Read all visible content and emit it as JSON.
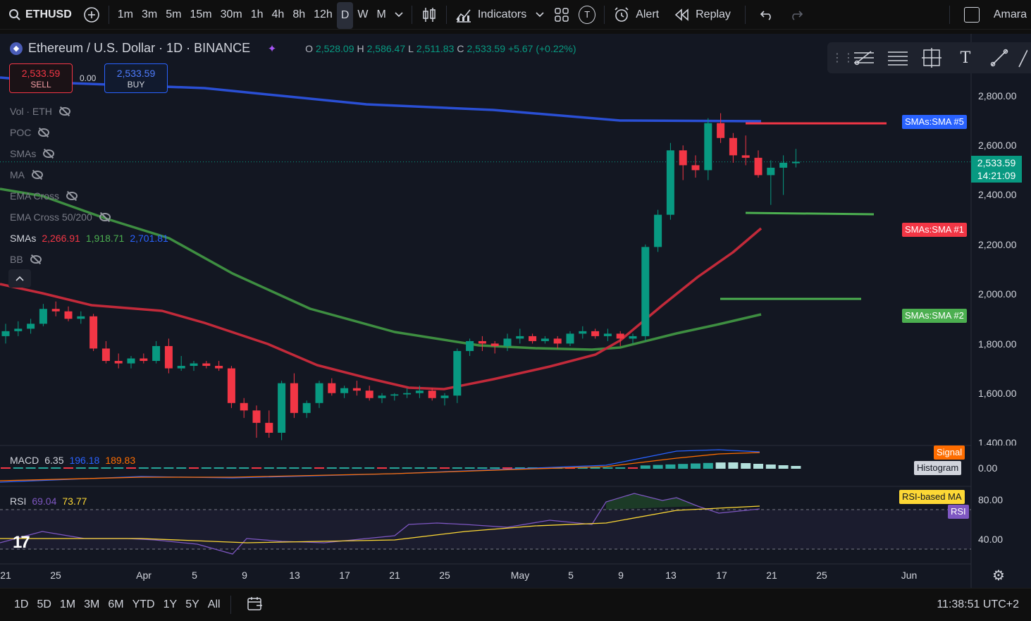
{
  "topbar": {
    "symbol": "ETHUSD",
    "intervals": [
      "1m",
      "3m",
      "5m",
      "15m",
      "30m",
      "1h",
      "4h",
      "8h",
      "12h",
      "D",
      "W",
      "M"
    ],
    "active_interval": "D",
    "indicators_label": "Indicators",
    "alert_label": "Alert",
    "replay_label": "Replay",
    "user_label": "Amara",
    "t_badge": "T"
  },
  "legend": {
    "title": "Ethereum / U.S. Dollar · 1D · BINANCE",
    "o_key": "O",
    "o_val": "2,528.09",
    "h_key": "H",
    "h_val": "2,586.47",
    "l_key": "L",
    "l_val": "2,511.83",
    "c_key": "C",
    "c_val": "2,533.59",
    "change": "+5.67 (+0.22%)"
  },
  "trade": {
    "sell_price": "2,533.59",
    "sell_label": "SELL",
    "buy_price": "2,533.59",
    "buy_label": "BUY",
    "spread": "0.00"
  },
  "indicators": [
    {
      "label": "Vol · ETH"
    },
    {
      "label": "POC"
    },
    {
      "label": "SMAs"
    },
    {
      "label": "MA"
    },
    {
      "label": "EMA Cross"
    },
    {
      "label": "EMA Cross 50/200"
    }
  ],
  "smas_line": {
    "label": "SMAs",
    "v1": "2,266.91",
    "v2": "1,918.71",
    "v3": "2,701.81"
  },
  "bb_label": "BB",
  "price_axis": [
    "2,800.00",
    "2,600.00",
    "2,400.00",
    "2,200.00",
    "2,000.00",
    "1,800.00",
    "1,600.00",
    "1,400.00"
  ],
  "current_price": {
    "price": "2,533.59",
    "countdown": "14:21:09"
  },
  "sma_tags": {
    "sma5": {
      "label": "SMAs:SMA #5",
      "color": "#2962ff"
    },
    "sma1": {
      "label": "SMAs:SMA #1",
      "color": "#f23645"
    },
    "sma2": {
      "label": "SMAs:SMA #2",
      "color": "#4caf50"
    }
  },
  "macd": {
    "label": "MACD",
    "v1": "6.35",
    "v2": "196.18",
    "v3": "189.83",
    "signal_tag": "Signal",
    "histogram_tag": "Histogram",
    "zero": "0.00"
  },
  "rsi": {
    "label": "RSI",
    "v1": "69.04",
    "v2": "73.77",
    "ma_tag": "RSI-based MA",
    "rsi_tag": "RSI",
    "level80": "80.00",
    "level40": "40.00"
  },
  "time_axis": [
    "21",
    "25",
    "Apr",
    "5",
    "9",
    "13",
    "17",
    "21",
    "25",
    "May",
    "5",
    "9",
    "13",
    "17",
    "21",
    "25",
    "Jun"
  ],
  "bottombar": {
    "ranges": [
      "1D",
      "5D",
      "1M",
      "3M",
      "6M",
      "YTD",
      "1Y",
      "5Y",
      "All"
    ],
    "clock": "11:38:51 UTC+2"
  },
  "colors": {
    "up": "#089981",
    "down": "#f23645",
    "sma5": "#2a4fd4",
    "sma1": "#c22a3a",
    "sma2": "#3e8e41"
  },
  "chart_data": {
    "type": "candlestick",
    "candles": [
      [
        1830,
        1880,
        1800,
        1850
      ],
      [
        1850,
        1890,
        1830,
        1860
      ],
      [
        1860,
        1900,
        1840,
        1880
      ],
      [
        1880,
        1960,
        1870,
        1940
      ],
      [
        1940,
        1970,
        1910,
        1930
      ],
      [
        1930,
        1950,
        1890,
        1900
      ],
      [
        1900,
        1930,
        1880,
        1910
      ],
      [
        1910,
        1920,
        1770,
        1780
      ],
      [
        1780,
        1810,
        1720,
        1730
      ],
      [
        1730,
        1760,
        1700,
        1720
      ],
      [
        1720,
        1750,
        1700,
        1740
      ],
      [
        1740,
        1760,
        1720,
        1730
      ],
      [
        1730,
        1810,
        1720,
        1790
      ],
      [
        1790,
        1820,
        1680,
        1700
      ],
      [
        1700,
        1750,
        1690,
        1710
      ],
      [
        1710,
        1730,
        1690,
        1720
      ],
      [
        1720,
        1730,
        1700,
        1710
      ],
      [
        1710,
        1730,
        1690,
        1700
      ],
      [
        1700,
        1710,
        1540,
        1560
      ],
      [
        1560,
        1580,
        1500,
        1530
      ],
      [
        1530,
        1550,
        1420,
        1480
      ],
      [
        1480,
        1530,
        1420,
        1440
      ],
      [
        1440,
        1650,
        1410,
        1640
      ],
      [
        1640,
        1680,
        1500,
        1520
      ],
      [
        1520,
        1570,
        1500,
        1560
      ],
      [
        1560,
        1650,
        1540,
        1640
      ],
      [
        1640,
        1660,
        1590,
        1600
      ],
      [
        1600,
        1630,
        1580,
        1620
      ],
      [
        1620,
        1650,
        1590,
        1610
      ],
      [
        1610,
        1630,
        1570,
        1580
      ],
      [
        1580,
        1600,
        1560,
        1590
      ],
      [
        1590,
        1600,
        1570,
        1595
      ],
      [
        1595,
        1620,
        1580,
        1600
      ],
      [
        1600,
        1630,
        1580,
        1610
      ],
      [
        1610,
        1620,
        1570,
        1580
      ],
      [
        1580,
        1600,
        1550,
        1590
      ],
      [
        1590,
        1780,
        1560,
        1770
      ],
      [
        1770,
        1820,
        1750,
        1810
      ],
      [
        1810,
        1830,
        1770,
        1800
      ],
      [
        1800,
        1810,
        1760,
        1790
      ],
      [
        1790,
        1840,
        1770,
        1820
      ],
      [
        1820,
        1860,
        1800,
        1830
      ],
      [
        1830,
        1840,
        1800,
        1810
      ],
      [
        1810,
        1830,
        1800,
        1820
      ],
      [
        1820,
        1830,
        1780,
        1800
      ],
      [
        1800,
        1850,
        1790,
        1840
      ],
      [
        1840,
        1870,
        1820,
        1850
      ],
      [
        1850,
        1860,
        1820,
        1830
      ],
      [
        1830,
        1860,
        1810,
        1840
      ],
      [
        1840,
        1850,
        1790,
        1820
      ],
      [
        1820,
        1840,
        1800,
        1830
      ],
      [
        1830,
        2200,
        1810,
        2190
      ],
      [
        2190,
        2340,
        2170,
        2320
      ],
      [
        2320,
        2610,
        2300,
        2580
      ],
      [
        2580,
        2600,
        2460,
        2520
      ],
      [
        2520,
        2560,
        2470,
        2500
      ],
      [
        2500,
        2710,
        2460,
        2690
      ],
      [
        2690,
        2730,
        2610,
        2630
      ],
      [
        2630,
        2650,
        2530,
        2560
      ],
      [
        2560,
        2640,
        2520,
        2550
      ],
      [
        2550,
        2580,
        2470,
        2480
      ],
      [
        2480,
        2540,
        2360,
        2510
      ],
      [
        2510,
        2560,
        2400,
        2530
      ],
      [
        2528,
        2586,
        2511,
        2534
      ]
    ],
    "y_range": [
      1400,
      2800
    ],
    "sma_tags": [
      "SMAs:SMA #5",
      "SMAs:SMA #1",
      "SMAs:SMA #2"
    ]
  }
}
